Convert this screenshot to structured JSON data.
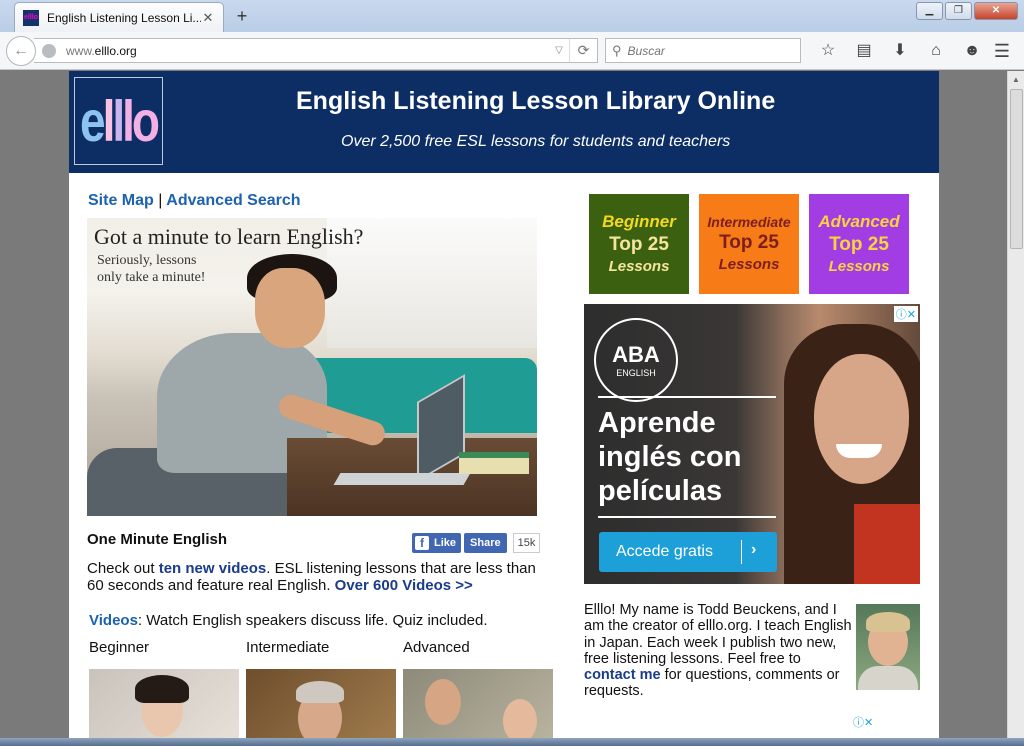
{
  "browser": {
    "tab_title": "English Listening Lesson Li...",
    "tab_close": "✕",
    "new_tab": "+",
    "favicon_text": "elllo",
    "url_prefix": "www.",
    "url_host": "elllo.org",
    "search_placeholder": "Buscar",
    "window_buttons": [
      "▁",
      "❐",
      "✕"
    ]
  },
  "header": {
    "logo": [
      "e",
      "l",
      "l",
      "lo"
    ],
    "title": "English Listening Lesson Library Online",
    "subtitle": "Over 2,500 free ESL lessons for students and teachers"
  },
  "links": {
    "site_map": "Site Map",
    "separator": "|",
    "advanced_search": "Advanced Search"
  },
  "hero": {
    "headline": "Got a minute to learn English?",
    "subline": "Seriously, lessons\nonly take a minute!"
  },
  "one_minute": {
    "title": "One Minute English",
    "like_label": "Like",
    "share_label": "Share",
    "share_count": "15k",
    "text_before": "Check out ",
    "link_new_videos": "ten new videos",
    "text_middle": ". ESL listening lessons that are less than 60 seconds and feature real English. ",
    "link_600": "Over 600 Videos >>"
  },
  "videos": {
    "label": "Videos",
    "text": ": Watch English speakers discuss life. Quiz included.",
    "levels": [
      "Beginner",
      "Intermediate",
      "Advanced"
    ]
  },
  "top25": [
    {
      "level": "Beginner",
      "top": "Top 25",
      "lessons": "Lessons"
    },
    {
      "level": "Intermediate",
      "top": "Top 25",
      "lessons": "Lessons"
    },
    {
      "level": "Advanced",
      "top": "Top 25",
      "lessons": "Lessons"
    }
  ],
  "ad": {
    "brand": "ABA",
    "brand_sub": "ENGLISH",
    "headline": "Aprende\ninglés con\npelículas",
    "cta": "Accede gratis",
    "cta_chevron": "›",
    "adchoices": "ⓘ✕"
  },
  "bio": {
    "text_before": "Elllo! My name is Todd Beuckens, and I am the creator of elllo.org. I teach English in Japan. Each week I publish two new, free listening lessons. Feel free to ",
    "contact_link": "contact me",
    "text_after": " for questions, comments or requests."
  },
  "colors": {
    "header_bg": "#0c2e65",
    "link_blue": "#1d62b0",
    "beginner_bg": "#3b6110",
    "intermediate_bg": "#f77c17",
    "advanced_bg": "#a23de4",
    "ad_cta": "#1da0d8"
  }
}
